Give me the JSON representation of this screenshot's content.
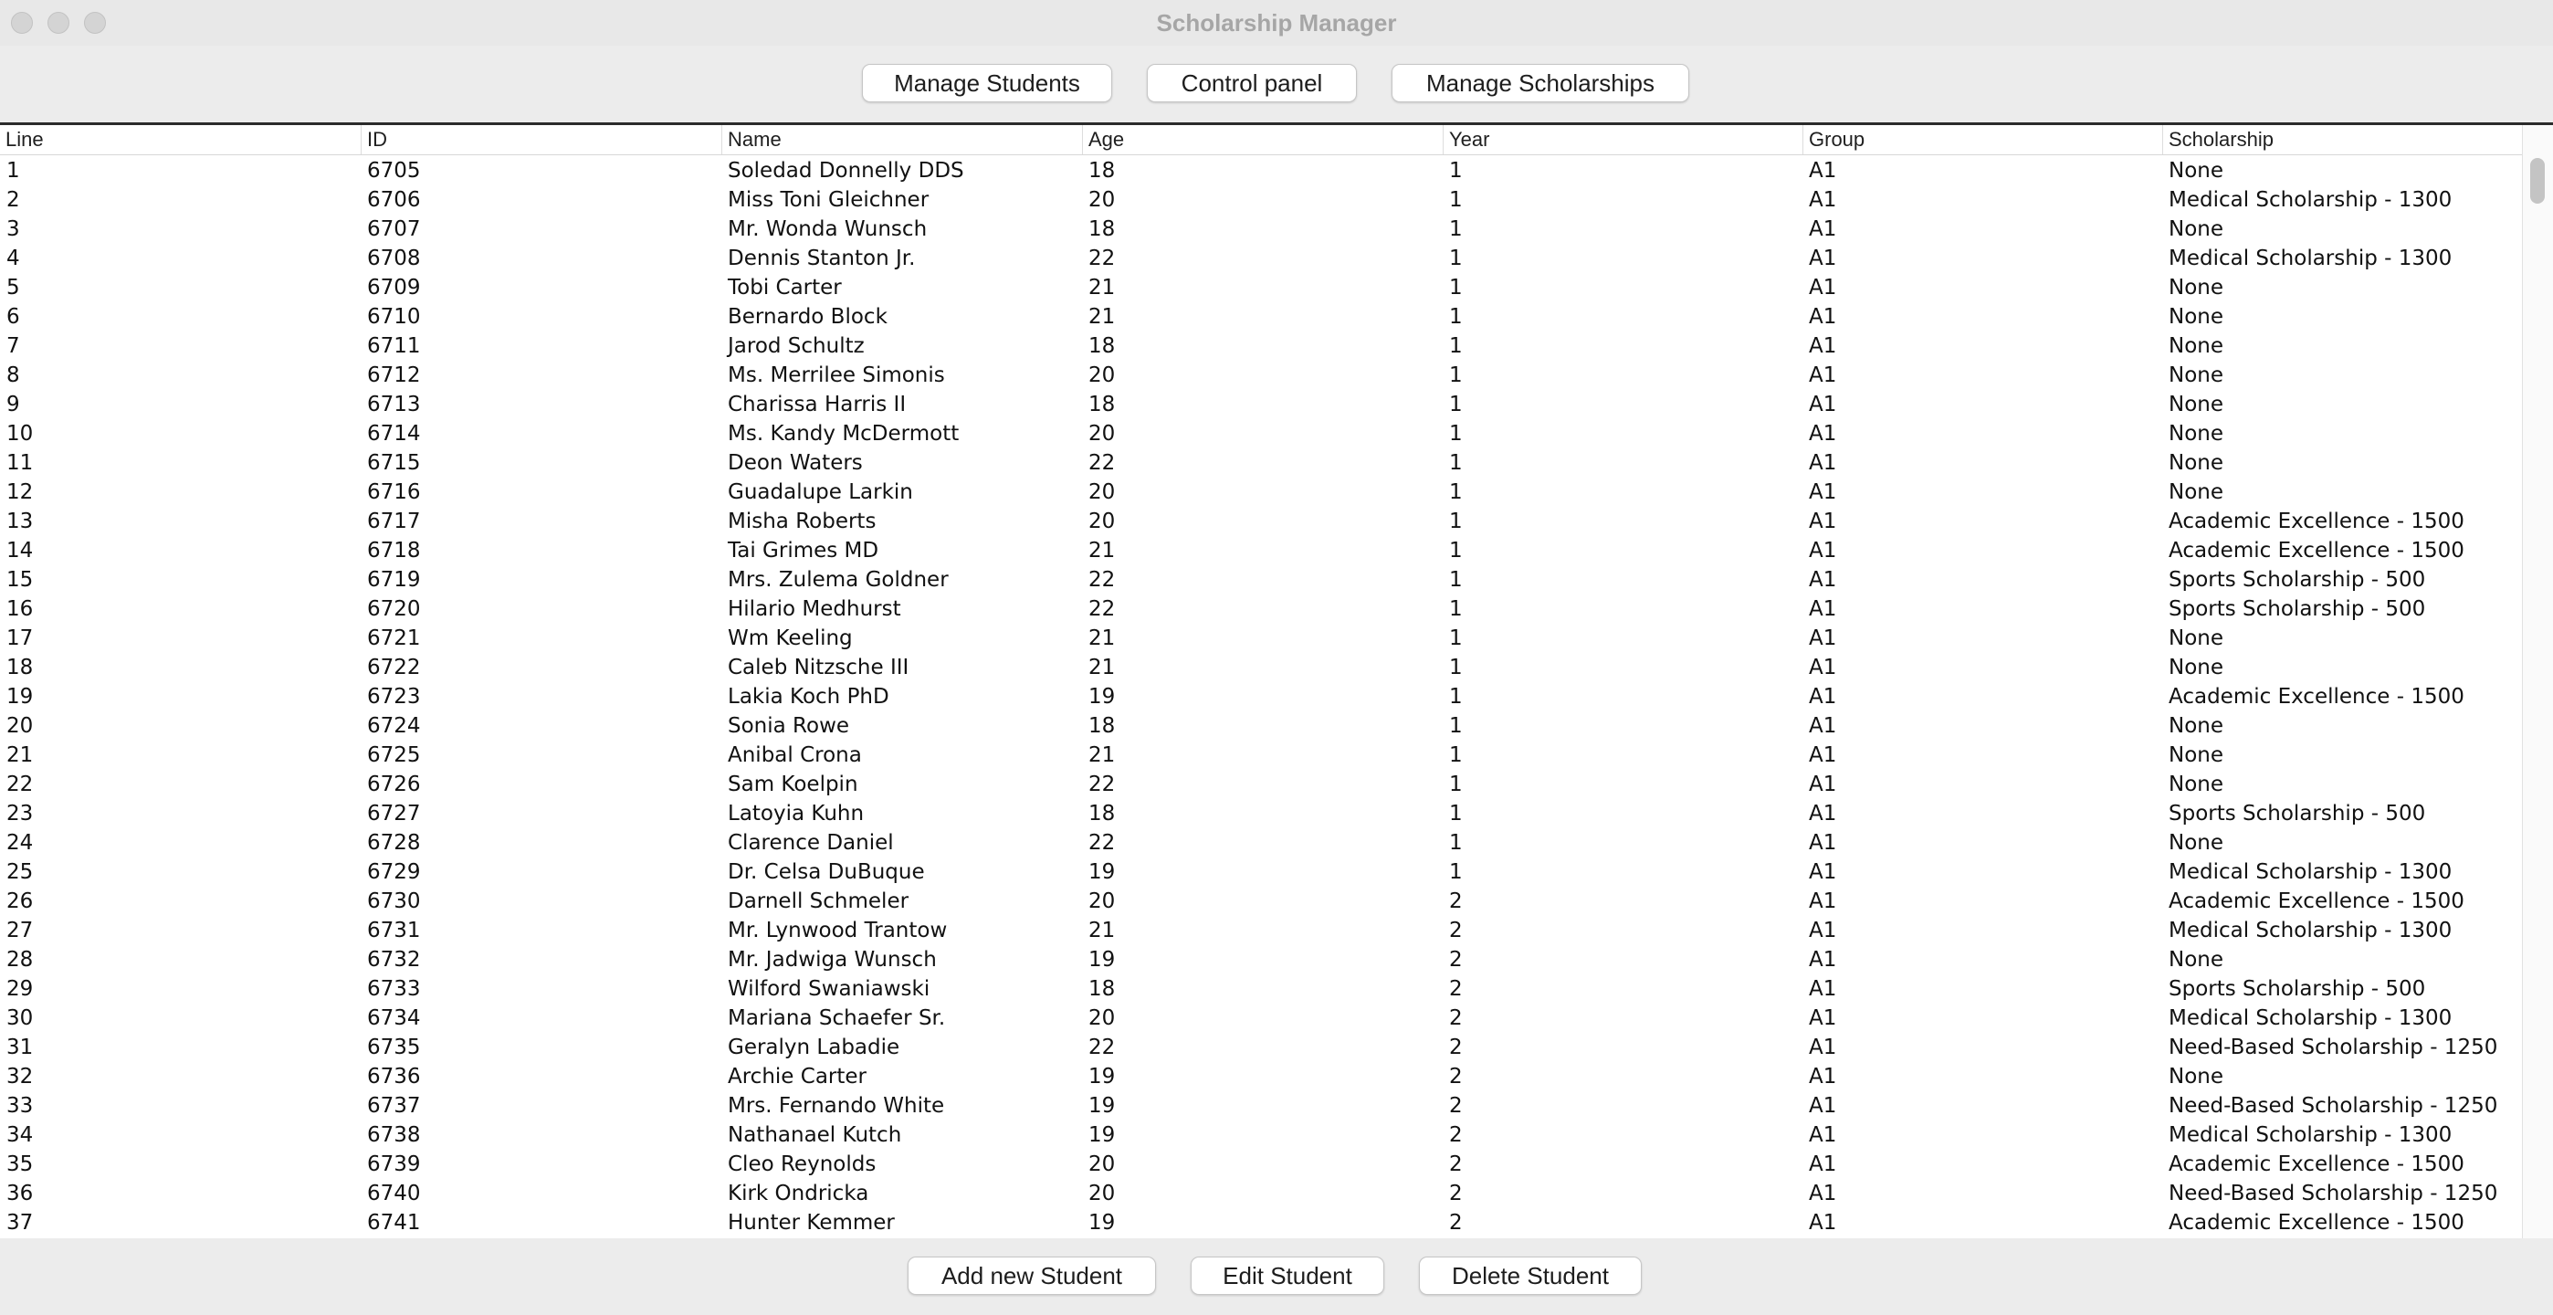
{
  "window": {
    "title": "Scholarship Manager"
  },
  "toolbar": {
    "manage_students": "Manage Students",
    "control_panel": "Control panel",
    "manage_scholarships": "Manage Scholarships"
  },
  "table": {
    "columns": [
      "Line",
      "ID",
      "Name",
      "Age",
      "Year",
      "Group",
      "Scholarship"
    ],
    "rows": [
      [
        "1",
        "6705",
        "Soledad Donnelly DDS",
        "18",
        "1",
        "A1",
        "None"
      ],
      [
        "2",
        "6706",
        "Miss Toni Gleichner",
        "20",
        "1",
        "A1",
        "Medical Scholarship - 1300"
      ],
      [
        "3",
        "6707",
        "Mr. Wonda Wunsch",
        "18",
        "1",
        "A1",
        "None"
      ],
      [
        "4",
        "6708",
        "Dennis Stanton Jr.",
        "22",
        "1",
        "A1",
        "Medical Scholarship - 1300"
      ],
      [
        "5",
        "6709",
        "Tobi Carter",
        "21",
        "1",
        "A1",
        "None"
      ],
      [
        "6",
        "6710",
        "Bernardo Block",
        "21",
        "1",
        "A1",
        "None"
      ],
      [
        "7",
        "6711",
        "Jarod Schultz",
        "18",
        "1",
        "A1",
        "None"
      ],
      [
        "8",
        "6712",
        "Ms. Merrilee Simonis",
        "20",
        "1",
        "A1",
        "None"
      ],
      [
        "9",
        "6713",
        "Charissa Harris II",
        "18",
        "1",
        "A1",
        "None"
      ],
      [
        "10",
        "6714",
        "Ms. Kandy McDermott",
        "20",
        "1",
        "A1",
        "None"
      ],
      [
        "11",
        "6715",
        "Deon Waters",
        "22",
        "1",
        "A1",
        "None"
      ],
      [
        "12",
        "6716",
        "Guadalupe Larkin",
        "20",
        "1",
        "A1",
        "None"
      ],
      [
        "13",
        "6717",
        "Misha Roberts",
        "20",
        "1",
        "A1",
        "Academic Excellence - 1500"
      ],
      [
        "14",
        "6718",
        "Tai Grimes MD",
        "21",
        "1",
        "A1",
        "Academic Excellence - 1500"
      ],
      [
        "15",
        "6719",
        "Mrs. Zulema Goldner",
        "22",
        "1",
        "A1",
        "Sports Scholarship - 500"
      ],
      [
        "16",
        "6720",
        "Hilario Medhurst",
        "22",
        "1",
        "A1",
        "Sports Scholarship - 500"
      ],
      [
        "17",
        "6721",
        "Wm Keeling",
        "21",
        "1",
        "A1",
        "None"
      ],
      [
        "18",
        "6722",
        "Caleb Nitzsche III",
        "21",
        "1",
        "A1",
        "None"
      ],
      [
        "19",
        "6723",
        "Lakia Koch PhD",
        "19",
        "1",
        "A1",
        "Academic Excellence - 1500"
      ],
      [
        "20",
        "6724",
        "Sonia Rowe",
        "18",
        "1",
        "A1",
        "None"
      ],
      [
        "21",
        "6725",
        "Anibal Crona",
        "21",
        "1",
        "A1",
        "None"
      ],
      [
        "22",
        "6726",
        "Sam Koelpin",
        "22",
        "1",
        "A1",
        "None"
      ],
      [
        "23",
        "6727",
        "Latoyia Kuhn",
        "18",
        "1",
        "A1",
        "Sports Scholarship - 500"
      ],
      [
        "24",
        "6728",
        "Clarence Daniel",
        "22",
        "1",
        "A1",
        "None"
      ],
      [
        "25",
        "6729",
        "Dr. Celsa DuBuque",
        "19",
        "1",
        "A1",
        "Medical Scholarship - 1300"
      ],
      [
        "26",
        "6730",
        "Darnell Schmeler",
        "20",
        "2",
        "A1",
        "Academic Excellence - 1500"
      ],
      [
        "27",
        "6731",
        "Mr. Lynwood Trantow",
        "21",
        "2",
        "A1",
        "Medical Scholarship - 1300"
      ],
      [
        "28",
        "6732",
        "Mr. Jadwiga Wunsch",
        "19",
        "2",
        "A1",
        "None"
      ],
      [
        "29",
        "6733",
        "Wilford Swaniawski",
        "18",
        "2",
        "A1",
        "Sports Scholarship - 500"
      ],
      [
        "30",
        "6734",
        "Mariana Schaefer Sr.",
        "20",
        "2",
        "A1",
        "Medical Scholarship - 1300"
      ],
      [
        "31",
        "6735",
        "Geralyn Labadie",
        "22",
        "2",
        "A1",
        "Need-Based Scholarship - 1250"
      ],
      [
        "32",
        "6736",
        "Archie Carter",
        "19",
        "2",
        "A1",
        "None"
      ],
      [
        "33",
        "6737",
        "Mrs. Fernando White",
        "19",
        "2",
        "A1",
        "Need-Based Scholarship - 1250"
      ],
      [
        "34",
        "6738",
        "Nathanael Kutch",
        "19",
        "2",
        "A1",
        "Medical Scholarship - 1300"
      ],
      [
        "35",
        "6739",
        "Cleo Reynolds",
        "20",
        "2",
        "A1",
        "Academic Excellence - 1500"
      ],
      [
        "36",
        "6740",
        "Kirk Ondricka",
        "20",
        "2",
        "A1",
        "Need-Based Scholarship - 1250"
      ],
      [
        "37",
        "6741",
        "Hunter Kemmer",
        "19",
        "2",
        "A1",
        "Academic Excellence - 1500"
      ]
    ]
  },
  "footer": {
    "add_student": "Add new Student",
    "edit_student": "Edit Student",
    "delete_student": "Delete Student"
  }
}
